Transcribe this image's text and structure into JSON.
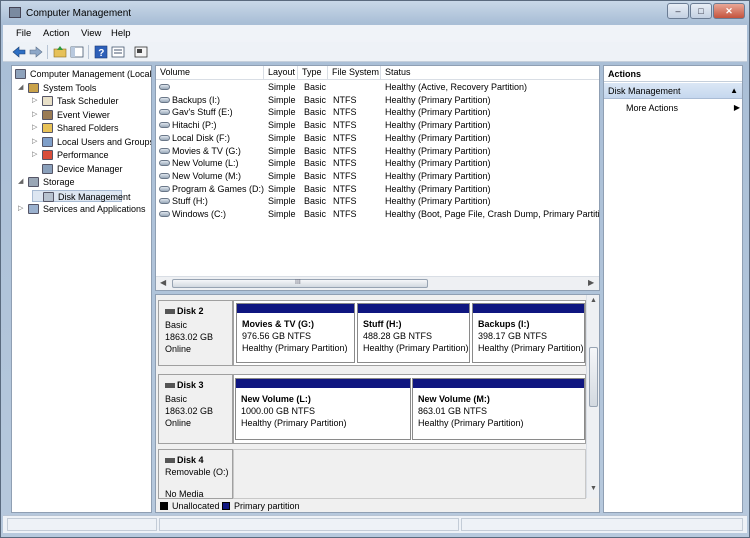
{
  "window": {
    "title": "Computer Management",
    "controls": [
      "–",
      "□",
      "✕"
    ]
  },
  "menu": [
    "File",
    "Action",
    "View",
    "Help"
  ],
  "toolbar": [
    "back-icon",
    "forward-icon",
    "up-folder-icon",
    "show-hide-tree-icon",
    "help-icon",
    "properties-icon",
    "console-icon"
  ],
  "tree": {
    "root": "Computer Management (Local",
    "items": [
      {
        "label": "System Tools",
        "level": 1,
        "expander": "◢",
        "icon": "tools-icon",
        "color": "#c9a24a"
      },
      {
        "label": "Task Scheduler",
        "level": 2,
        "expander": "▷",
        "icon": "clock-icon",
        "color": "#e8e0c8"
      },
      {
        "label": "Event Viewer",
        "level": 2,
        "expander": "▷",
        "icon": "event-viewer-icon",
        "color": "#9a7b54"
      },
      {
        "label": "Shared Folders",
        "level": 2,
        "expander": "▷",
        "icon": "shared-folder-icon",
        "color": "#e8c257"
      },
      {
        "label": "Local Users and Groups",
        "level": 2,
        "expander": "▷",
        "icon": "users-icon",
        "color": "#7f9fc9"
      },
      {
        "label": "Performance",
        "level": 2,
        "expander": "▷",
        "icon": "performance-icon",
        "color": "#d94d3a"
      },
      {
        "label": "Device Manager",
        "level": 2,
        "expander": "",
        "icon": "device-manager-icon",
        "color": "#8aa0bb"
      },
      {
        "label": "Storage",
        "level": 1,
        "expander": "◢",
        "icon": "storage-icon",
        "color": "#9aa7b6"
      },
      {
        "label": "Disk Management",
        "level": 2,
        "expander": "",
        "icon": "disk-icon",
        "color": "#b7c2cf",
        "selected": true
      },
      {
        "label": "Services and Applications",
        "level": 1,
        "expander": "▷",
        "icon": "services-icon",
        "color": "#9bb1ce"
      }
    ]
  },
  "volume_list": {
    "columns": [
      "Volume",
      "Layout",
      "Type",
      "File System",
      "Status"
    ],
    "rows": [
      [
        "",
        "Simple",
        "Basic",
        "",
        "Healthy (Active, Recovery Partition)"
      ],
      [
        "Backups (I:)",
        "Simple",
        "Basic",
        "NTFS",
        "Healthy (Primary Partition)"
      ],
      [
        "Gav's Stuff (E:)",
        "Simple",
        "Basic",
        "NTFS",
        "Healthy (Primary Partition)"
      ],
      [
        "Hitachi (P:)",
        "Simple",
        "Basic",
        "NTFS",
        "Healthy (Primary Partition)"
      ],
      [
        "Local Disk (F:)",
        "Simple",
        "Basic",
        "NTFS",
        "Healthy (Primary Partition)"
      ],
      [
        "Movies & TV (G:)",
        "Simple",
        "Basic",
        "NTFS",
        "Healthy (Primary Partition)"
      ],
      [
        "New Volume (L:)",
        "Simple",
        "Basic",
        "NTFS",
        "Healthy (Primary Partition)"
      ],
      [
        "New Volume (M:)",
        "Simple",
        "Basic",
        "NTFS",
        "Healthy (Primary Partition)"
      ],
      [
        "Program & Games (D:)",
        "Simple",
        "Basic",
        "NTFS",
        "Healthy (Primary Partition)"
      ],
      [
        "Stuff (H:)",
        "Simple",
        "Basic",
        "NTFS",
        "Healthy (Primary Partition)"
      ],
      [
        "Windows (C:)",
        "Simple",
        "Basic",
        "NTFS",
        "Healthy (Boot, Page File, Crash Dump, Primary Partitio"
      ]
    ],
    "scroll_grip": "III"
  },
  "disks": [
    {
      "name": "Disk 2",
      "type": "Basic",
      "size": "1863.02 GB",
      "state": "Online",
      "partitions": [
        {
          "name": "Movies & TV  (G:)",
          "size": "976.56 GB NTFS",
          "status": "Healthy (Primary Partition)"
        },
        {
          "name": "Stuff  (H:)",
          "size": "488.28 GB NTFS",
          "status": "Healthy (Primary Partition)"
        },
        {
          "name": "Backups  (I:)",
          "size": "398.17 GB NTFS",
          "status": "Healthy (Primary Partition)"
        }
      ]
    },
    {
      "name": "Disk 3",
      "type": "Basic",
      "size": "1863.02 GB",
      "state": "Online",
      "partitions": [
        {
          "name": "New Volume  (L:)",
          "size": "1000.00 GB NTFS",
          "status": "Healthy (Primary Partition)"
        },
        {
          "name": "New Volume  (M:)",
          "size": "863.01 GB NTFS",
          "status": "Healthy (Primary Partition)"
        }
      ]
    },
    {
      "name": "Disk 4",
      "type": "Removable (O:)",
      "size": "",
      "state": "No Media",
      "partitions": []
    }
  ],
  "legend": [
    {
      "label": "Unallocated",
      "color": "#000000"
    },
    {
      "label": "Primary partition",
      "color": "#0f1680"
    }
  ],
  "actions": {
    "header": "Actions",
    "section": "Disk Management",
    "more": "More Actions",
    "more_arrow": "▶"
  },
  "colors": {
    "partition_bar": "#0f1680",
    "selection": "#dde6f1"
  }
}
